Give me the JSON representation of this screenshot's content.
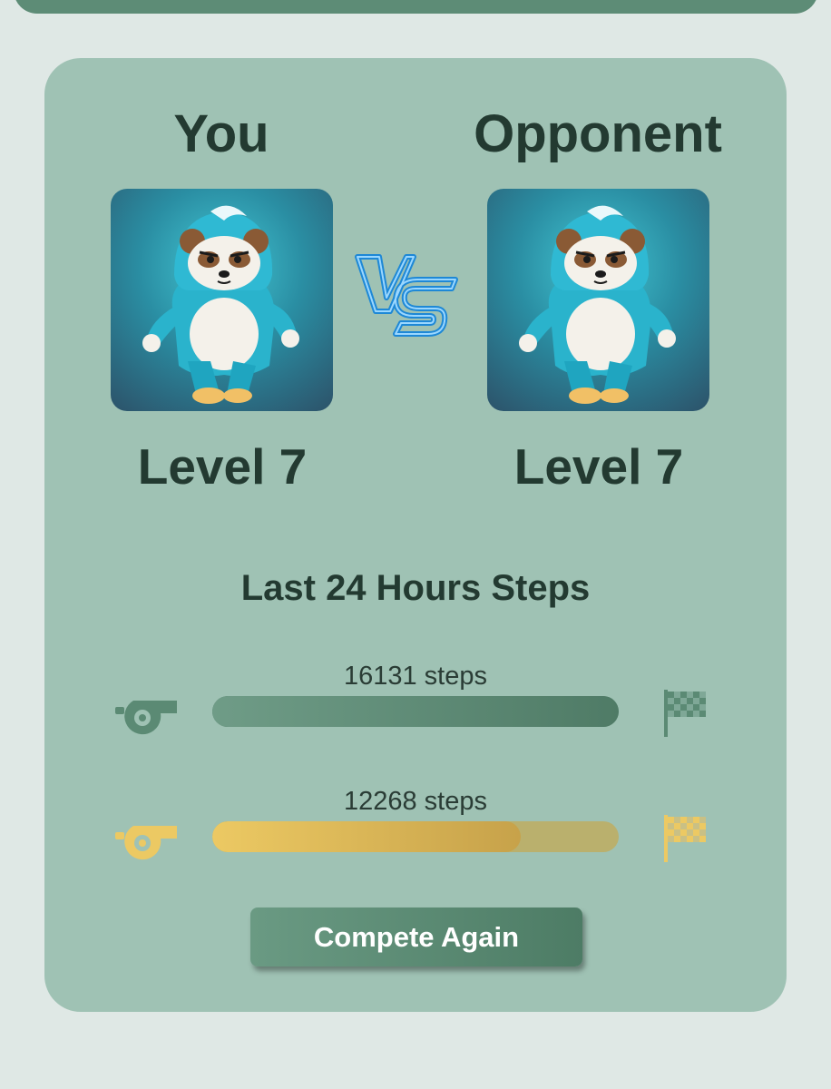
{
  "player": {
    "title": "You",
    "level_label": "Level 7",
    "steps_label": "16131 steps",
    "progress_fraction": 1.0
  },
  "opponent": {
    "title": "Opponent",
    "level_label": "Level 7",
    "steps_label": "12268 steps",
    "progress_fraction": 0.76
  },
  "section_title": "Last 24 Hours Steps",
  "compete_button_label": "Compete Again",
  "icons": {
    "start": "whistle-icon",
    "finish": "checkered-flag-icon",
    "versus": "vs-icon",
    "avatar": "panda-character"
  },
  "colors": {
    "background": "#dfe8e5",
    "card": "#9fc2b4",
    "player_bar": "#4f7b66",
    "opponent_bar": "#ecc963",
    "opponent_track": "#bab06d",
    "text": "#233a31",
    "button": "#5a8a73"
  }
}
